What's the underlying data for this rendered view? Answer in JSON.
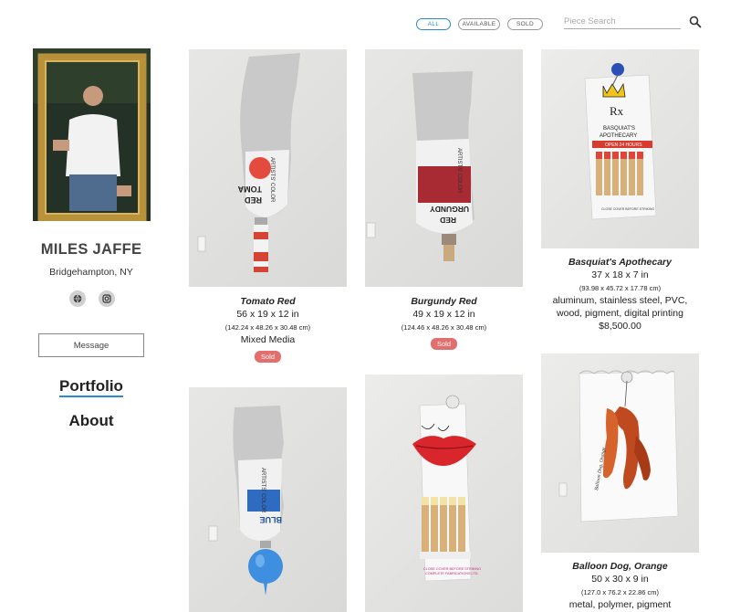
{
  "filters": {
    "all": "ALL",
    "available": "AVAILABLE",
    "sold": "SOLD",
    "active": "all"
  },
  "search": {
    "placeholder": "Piece Search"
  },
  "artist": {
    "name": "MILES JAFFE",
    "location": "Bridgehampton, NY"
  },
  "social": [
    "globe-icon",
    "instagram-icon"
  ],
  "message_label": "Message",
  "nav": {
    "portfolio": "Portfolio",
    "about": "About"
  },
  "colors": {
    "accent": "#2a8ad0",
    "sold_badge": "#e26e6e"
  },
  "artworks": [
    {
      "title": "Tomato Red",
      "dims_in": "56 x 19 x 12 in",
      "dims_cm": "(142.24 x 48.26 x 30.48 cm)",
      "medium": "Mixed Media",
      "status": "Sold"
    },
    {
      "title": "Burgundy Red",
      "dims_in": "49 x 19 x 12 in",
      "dims_cm": "(124.46 x 48.26 x 30.48 cm)",
      "medium": "",
      "status": "Sold"
    },
    {
      "title": "Basquiat's Apothecary",
      "dims_in": "37 x 18 x 7 in",
      "dims_cm": "(93.98 x 45.72 x 17.78 cm)",
      "medium_1": "aluminum, stainless steel, PVC,",
      "medium_2": "wood, pigment, digital printing",
      "price": "$8,500.00"
    },
    {
      "title": "",
      "dims_in": "",
      "dims_cm": ""
    },
    {
      "title": "",
      "dims_in": "",
      "dims_cm": ""
    },
    {
      "title": "Balloon Dog, Orange",
      "dims_in": "50 x 30 x 9 in",
      "dims_cm": "(127.0 x 76.2 x 22.86 cm)",
      "medium": "metal, polymer, pigment"
    }
  ],
  "art_text": {
    "tomato": {
      "brand": "ARTISTS' COLOR",
      "name_1": "TOMA",
      "name_2": "RED"
    },
    "burgundy": {
      "brand": "ARTISTS' COLOR",
      "name_1": "URGUNDY",
      "name_2": "RED"
    },
    "basquiat": {
      "rx": "Rx",
      "l1": "BASQUIAT'S",
      "l2": "APOTHECARY",
      "l3": "OPEN 24 HOURS",
      "fine": "CLOSE COVER BEFORE STRIKING"
    },
    "blue": {
      "brand": "ARTISTS' COLOR",
      "name": "BLUE"
    },
    "lips": {
      "fine_1": "CLOSE COVER BEFORE STRIKING",
      "fine_2": "COMPLETE FABRICATIONS LTD."
    },
    "balloon": {
      "script": "Balloon Dog, Orange"
    }
  }
}
